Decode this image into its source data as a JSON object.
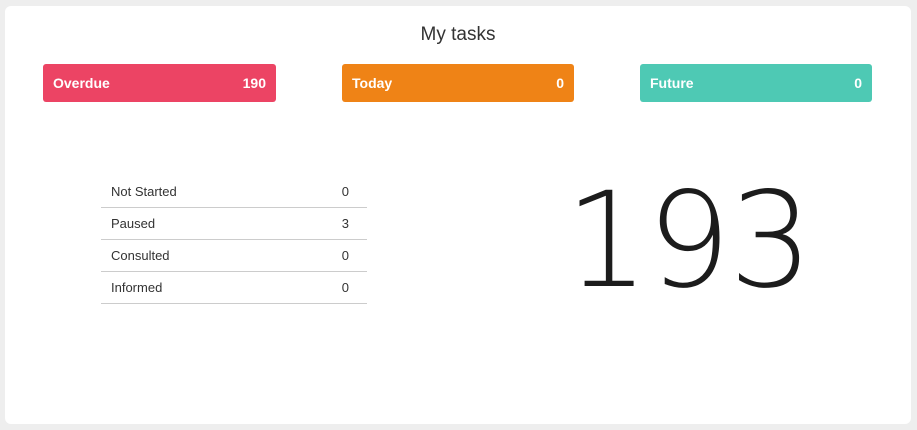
{
  "title": "My tasks",
  "tiles": [
    {
      "label": "Overdue",
      "value": "190",
      "color": "#ec4464"
    },
    {
      "label": "Today",
      "value": "0",
      "color": "#ef8316"
    },
    {
      "label": "Future",
      "value": "0",
      "color": "#4ec9b4"
    }
  ],
  "status_rows": [
    {
      "label": "Not Started",
      "value": "0"
    },
    {
      "label": "Paused",
      "value": "3"
    },
    {
      "label": "Consulted",
      "value": "0"
    },
    {
      "label": "Informed",
      "value": "0"
    }
  ],
  "total": "193"
}
